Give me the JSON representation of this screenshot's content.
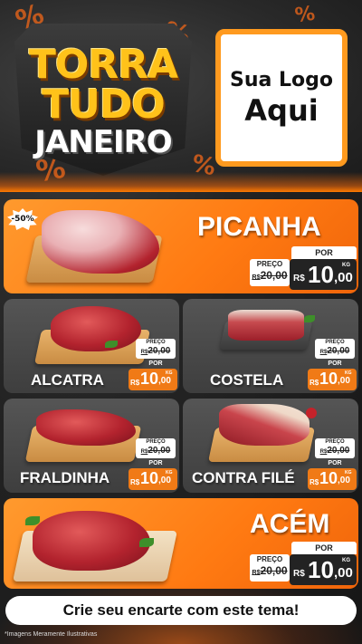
{
  "header": {
    "title_line1": "TORRA",
    "title_line2": "TUDO",
    "title_line3": "JANEIRO",
    "percent_symbol": "%",
    "logo_line1": "Sua Logo",
    "logo_line2": "Aqui"
  },
  "colors": {
    "accent": "#ff8a1f",
    "title_yellow": "#ffc21a",
    "dark_price_box": "#232323"
  },
  "discount_badge": "-50%",
  "products": [
    {
      "name": "PICANHA",
      "por": "POR",
      "preco_label": "PREÇO",
      "old_currency": "R$",
      "old_price": "20,00",
      "currency": "R$",
      "price_int": "10",
      "price_dec": ",00",
      "unit": "KG"
    },
    {
      "name": "ALCATRA",
      "por": "POR",
      "preco_label": "PREÇO",
      "old_currency": "R$",
      "old_price": "20,00",
      "currency": "R$",
      "price_int": "10",
      "price_dec": ",00",
      "unit": "KG"
    },
    {
      "name": "COSTELA",
      "por": "POR",
      "preco_label": "PREÇO",
      "old_currency": "R$",
      "old_price": "20,00",
      "currency": "R$",
      "price_int": "10",
      "price_dec": ",00",
      "unit": "KG"
    },
    {
      "name": "FRALDINHA",
      "por": "POR",
      "preco_label": "PREÇO",
      "old_currency": "R$",
      "old_price": "20,00",
      "currency": "R$",
      "price_int": "10",
      "price_dec": ",00",
      "unit": "KG"
    },
    {
      "name": "CONTRA FILÉ",
      "por": "POR",
      "preco_label": "PREÇO",
      "old_currency": "R$",
      "old_price": "20,00",
      "currency": "R$",
      "price_int": "10",
      "price_dec": ",00",
      "unit": "KG"
    },
    {
      "name": "ACÉM",
      "por": "POR",
      "preco_label": "PREÇO",
      "old_currency": "R$",
      "old_price": "20,00",
      "currency": "R$",
      "price_int": "10",
      "price_dec": ",00",
      "unit": "KG"
    }
  ],
  "cta_text": "Crie seu encarte com este tema!",
  "footnote": "*Imagens Meramente Ilustrativas"
}
